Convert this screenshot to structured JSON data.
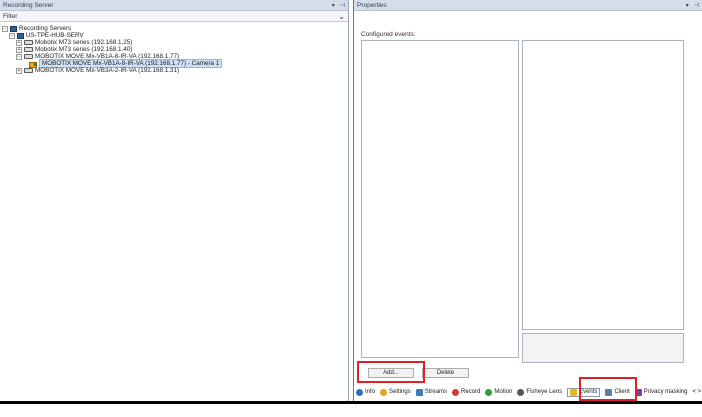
{
  "left_pane": {
    "title": "Recording Server",
    "pin_icon": "pin-icon",
    "dropdown_icon": "dropdown-icon",
    "filter_label": "Filter",
    "tree": {
      "root": "Recording Servers",
      "server": "US-TPE-HUB-SERV",
      "devices": [
        "Mobotix M73 series (192.168.1.25)",
        "Mobotix M73 series (192.168.1.40)",
        "MOBOTIX MOVE Mx-VB1A-8-IR-VA (192.168.1.77)",
        "MOBOTIX MOVE Mx-VB3A-2-IR-VA (192.168.1.31)"
      ],
      "selected_camera": "MOBOTIX MOVE Mx-VB1A-8-IR-VA (192.168.1.77) - Camera 1"
    }
  },
  "right_pane": {
    "title": "Properties",
    "configured_events_label": "Configured events:",
    "add_button": "Add...",
    "delete_button": "Delete",
    "tabs": [
      {
        "label": "Info",
        "icon": "info-icon",
        "color": "#2a6fc0"
      },
      {
        "label": "Settings",
        "icon": "settings-icon",
        "color": "#e7a21d"
      },
      {
        "label": "Streams",
        "icon": "streams-icon",
        "color": "#3c7fb8"
      },
      {
        "label": "Record",
        "icon": "record-icon",
        "color": "#d23a2a"
      },
      {
        "label": "Motion",
        "icon": "motion-icon",
        "color": "#3a9a3a"
      },
      {
        "label": "Fisheye Lens",
        "icon": "fisheye-icon",
        "color": "#555555"
      },
      {
        "label": "Events",
        "icon": "events-icon",
        "color": "#e6b81a"
      },
      {
        "label": "Client",
        "icon": "client-icon",
        "color": "#5b7fa8"
      },
      {
        "label": "Privacy masking",
        "icon": "privacy-icon",
        "color": "#7a3fa0"
      }
    ],
    "scroll_arrows": "< >"
  },
  "highlight_color": "#e0202a"
}
